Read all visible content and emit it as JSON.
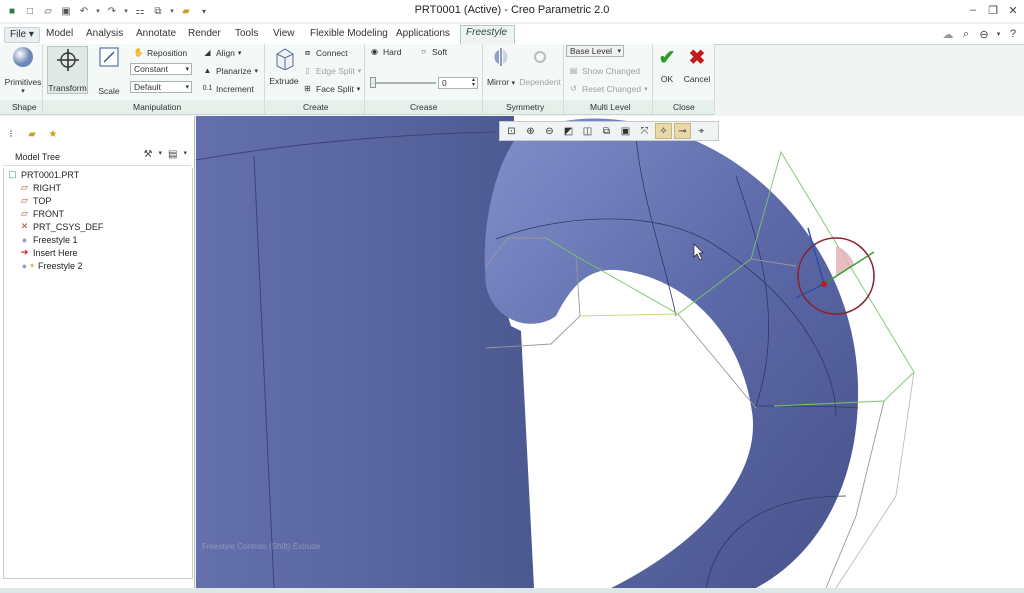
{
  "window": {
    "title": "PRT0001 (Active) - Creo Parametric 2.0"
  },
  "qat_icons": [
    "app-icon",
    "new-icon",
    "open-icon",
    "save-icon",
    "undo-icon",
    "redo-icon",
    "regenerate-icon",
    "windows-icon",
    "folder-icon",
    "customize-icon"
  ],
  "tabs": [
    {
      "id": "file",
      "label": "File ▾"
    },
    {
      "id": "model",
      "label": "Model"
    },
    {
      "id": "analysis",
      "label": "Analysis"
    },
    {
      "id": "annotate",
      "label": "Annotate"
    },
    {
      "id": "render",
      "label": "Render"
    },
    {
      "id": "tools",
      "label": "Tools"
    },
    {
      "id": "view",
      "label": "View"
    },
    {
      "id": "flexible",
      "label": "Flexible Modeling"
    },
    {
      "id": "applications",
      "label": "Applications"
    },
    {
      "id": "freestyle",
      "label": "Freestyle",
      "active": true
    }
  ],
  "ribbon": {
    "shape": {
      "primitives": "Primitives"
    },
    "manipulation": {
      "transform": "Transform",
      "scale": "Scale",
      "reposition": "Reposition",
      "constant": "Constant",
      "default": "Default",
      "align": "Align",
      "planarize": "Planarize",
      "increment": "Increment"
    },
    "create": {
      "extrude": "Extrude",
      "connect": "Connect",
      "edge_split": "Edge Split",
      "face_split": "Face Split"
    },
    "crease": {
      "hard": "Hard",
      "soft": "Soft",
      "value": "0",
      "slider_fraction": 0.0
    },
    "symmetry": {
      "mirror": "Mirror",
      "dependent": "Dependent"
    },
    "multilevel": {
      "base_level": "Base Level",
      "show_changed": "Show Changed",
      "reset_changed": "Reset Changed"
    },
    "close": {
      "ok": "OK",
      "cancel": "Cancel"
    }
  },
  "groups": [
    "Shape",
    "Manipulation",
    "Create",
    "Crease",
    "Symmetry",
    "Multi Level",
    "Close"
  ],
  "model_tree": {
    "header": "Model Tree",
    "items": [
      {
        "label": "PRT0001.PRT",
        "icon": "part-icon"
      },
      {
        "label": "RIGHT",
        "icon": "datum-plane-icon"
      },
      {
        "label": "TOP",
        "icon": "datum-plane-icon"
      },
      {
        "label": "FRONT",
        "icon": "datum-plane-icon"
      },
      {
        "label": "PRT_CSYS_DEF",
        "icon": "csys-icon"
      },
      {
        "label": "Freestyle 1",
        "icon": "freestyle-icon"
      },
      {
        "label": "Insert Here",
        "icon": "insert-arrow-icon"
      },
      {
        "label": "Freestyle 2",
        "icon": "freestyle-active-icon"
      }
    ]
  },
  "viewport": {
    "watermark": "Freestyle Controls (Shift) Extrude"
  },
  "colors": {
    "model": "#5f6aa3",
    "cage": "#7bc46a",
    "accent": "#c21b1b",
    "ok": "#2e9a2e"
  }
}
